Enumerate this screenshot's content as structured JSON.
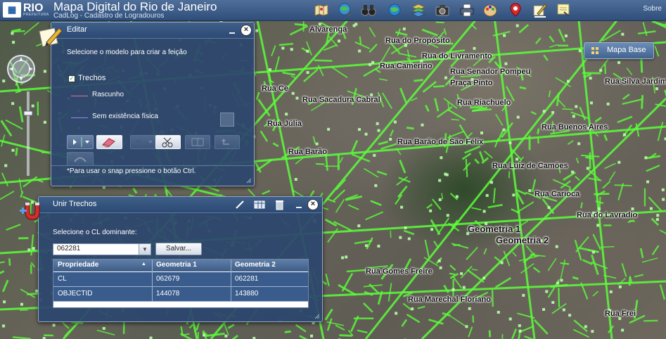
{
  "header": {
    "logo_text": "RIO",
    "logo_sub": "PREFEITURA",
    "title": "Mapa Digital do Rio de Janeiro",
    "subtitle": "CadLog - Cadastro de Logradouros",
    "sobre_label": "Sobre",
    "toolbar_icons": [
      "map-icon",
      "globe-search-icon",
      "binoculars-icon",
      "globe-icon",
      "layers-icon",
      "camera-icon",
      "printer-icon",
      "palette-icon",
      "pin-icon",
      "edit-icon",
      "note-icon"
    ]
  },
  "mapa_base": {
    "label": "Mapa Base"
  },
  "map_labels": [
    "Rua do Propósito",
    "Rua Sacadura Cabral",
    "Rua Camerino",
    "Rua do Livramento",
    "Rua Senador Pompeu",
    "Rua Barão de São Félix",
    "Rua Luiz de Camões",
    "Rua Carioca",
    "Rua Buenos Aires",
    "Geometria 1",
    "Geometria 2",
    "Alvarenga",
    "Rua Riachuelo",
    "Rua Silva Jardim",
    "Rua do Lavradio",
    "Rua Gomes Freire",
    "Rua Marechal Floriano",
    "Rua Júlia",
    "Rua Ce",
    "Praça Pinto",
    "Rua Barão",
    "Rua Frei"
  ],
  "editar": {
    "title": "Editar",
    "instruction": "Selecione o modelo para criar a feição",
    "trechos_label": "Trechos",
    "template1_label": "Rascunho",
    "template2_label": "Sem existência física",
    "footer": "*Para usar o snap pressione o botão Ctrl.",
    "tools": [
      "select-tool",
      "eraser-tool",
      "extend-tool",
      "scissors-tool",
      "split-tool",
      "undo-tool",
      "reshape-tool"
    ],
    "colors": {
      "rascunho": "#d37aa0",
      "sem_existencia": "#9a86e8"
    }
  },
  "unir": {
    "title": "Unir Trechos",
    "instruction": "Selecione o CL dominante:",
    "selected_value": "062281",
    "save_label": "Salvar...",
    "columns": [
      "Propriedade",
      "Geometria 1",
      "Geometria 2"
    ],
    "rows": [
      [
        "CL",
        "062679",
        "062281"
      ],
      [
        "OBJECTID",
        "144078",
        "143880"
      ]
    ]
  },
  "colors": {
    "header": "#2f4f7a",
    "panel": "#2c466e",
    "street_overlay": "#5cff3a"
  }
}
